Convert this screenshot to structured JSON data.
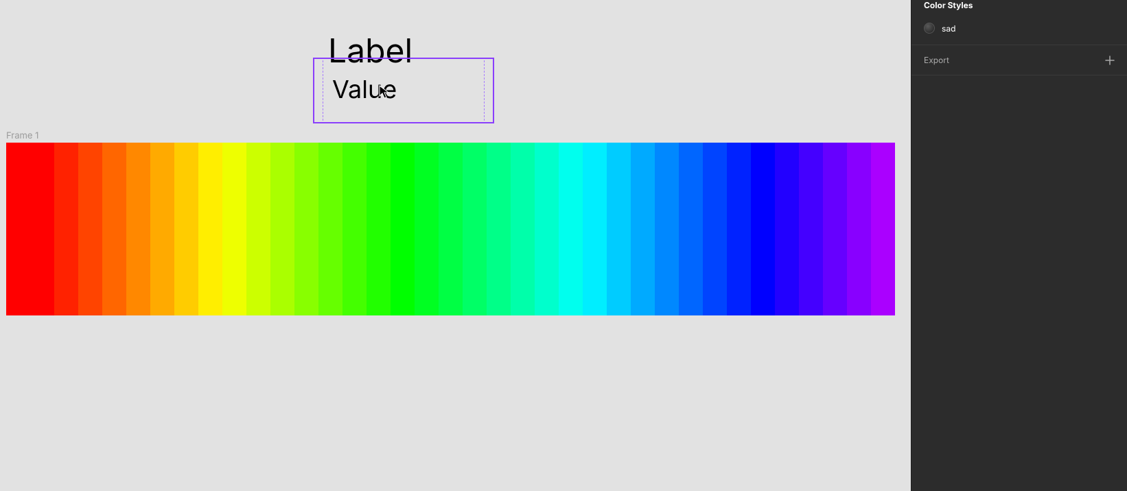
{
  "panel": {
    "color_styles_title": "Color Styles",
    "style_name": "sad",
    "export_label": "Export"
  },
  "canvas": {
    "component": {
      "label": "Label",
      "value": "Value"
    },
    "frame_label": "Frame 1"
  },
  "rainbow": {
    "segments": 36,
    "first_wide": true,
    "hue_range": [
      0,
      280
    ]
  }
}
